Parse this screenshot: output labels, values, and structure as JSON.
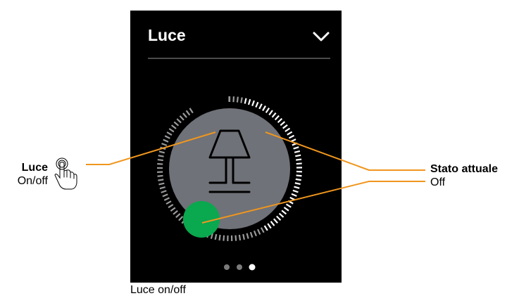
{
  "device": {
    "title": "Luce",
    "pages": {
      "count": 3,
      "active": 3
    }
  },
  "light_state": "Off",
  "annotations": {
    "left": {
      "title": "Luce",
      "subtitle": "On/off",
      "icon": "hand-tap-icon"
    },
    "right": {
      "title": "Stato attuale",
      "subtitle": "Off"
    }
  },
  "caption": "Luce on/off",
  "colors": {
    "background": "#000000",
    "knob": "#6f7278",
    "toggle": "#0aa84f",
    "leader_line": "#f0961e",
    "ticks": "#ffffff"
  }
}
